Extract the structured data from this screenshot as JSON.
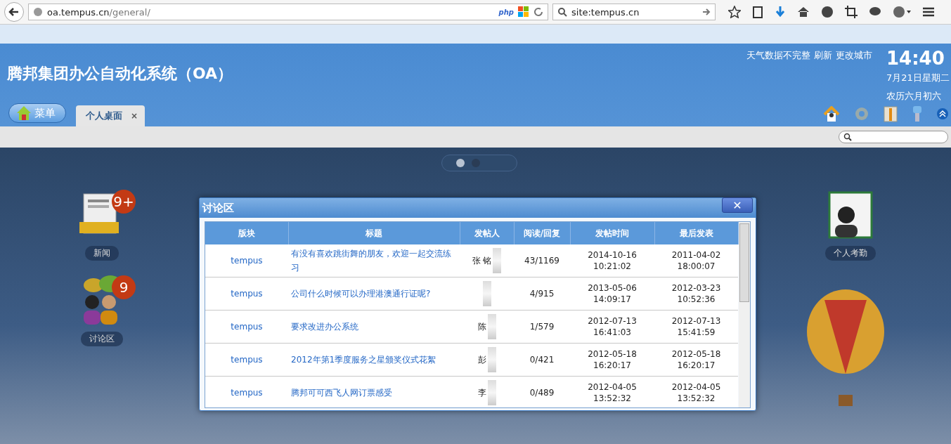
{
  "browser": {
    "url_host": "oa.tempus.cn",
    "url_path": "/general/",
    "search": "site:tempus.cn",
    "php_badge": "php"
  },
  "header": {
    "title": "腾邦集团办公自动化系统（OA）",
    "weather": "天气数据不完整",
    "weather_links": [
      "刷新",
      "更改城市"
    ],
    "time": "14:40",
    "date": "7月21日星期二",
    "lunar": "农历六月初六"
  },
  "menu_button": "菜单",
  "tabs": [
    {
      "label": "个人桌面",
      "selected": true,
      "close": "×"
    }
  ],
  "pager": [
    {
      "selected": true
    },
    {
      "selected": false
    }
  ],
  "desktop_icons": [
    {
      "label": "新闻",
      "kind": "news",
      "badge": "9+"
    },
    {
      "label": "讨论区",
      "kind": "forum",
      "badge": "9"
    },
    {
      "label": "个人考勤",
      "kind": "attendance"
    }
  ],
  "dialog": {
    "title": "讨论区",
    "close": "✕",
    "columns": [
      "版块",
      "标题",
      "发帖人",
      "阅读/回复",
      "发帖时间",
      "最后发表"
    ],
    "rows": [
      {
        "board": "tempus",
        "title": "有没有喜欢跳街舞的朋友，欢迎一起交流练习",
        "poster": "张  铭",
        "counts": "43/1169",
        "posted": [
          "2014-10-16",
          "10:21:02"
        ],
        "last": [
          "2011-04-02",
          "18:00:07"
        ]
      },
      {
        "board": "tempus",
        "title": "公司什么时候可以办理港澳通行证呢?",
        "counts": "4/915",
        "posted": [
          "2013-05-06",
          "14:09:17"
        ],
        "last": [
          "2012-03-23",
          "10:52:36"
        ]
      },
      {
        "board": "tempus",
        "title": "要求改进办公系统",
        "poster": "陈",
        "counts": "1/579",
        "posted": [
          "2012-07-13",
          "16:41:03"
        ],
        "last": [
          "2012-07-13",
          "15:41:59"
        ]
      },
      {
        "board": "tempus",
        "title": "2012年第1季度服务之星颁奖仪式花絮",
        "poster": "彭",
        "counts": "0/421",
        "posted": [
          "2012-05-18",
          "16:20:17"
        ],
        "last": [
          "2012-05-18",
          "16:20:17"
        ]
      },
      {
        "board": "tempus",
        "title": "腾邦可可西飞人网订票感受",
        "poster": "李",
        "counts": "0/489",
        "posted": [
          "2012-04-05",
          "13:52:32"
        ],
        "last": [
          "2012-04-05",
          "13:52:32"
        ]
      }
    ]
  }
}
